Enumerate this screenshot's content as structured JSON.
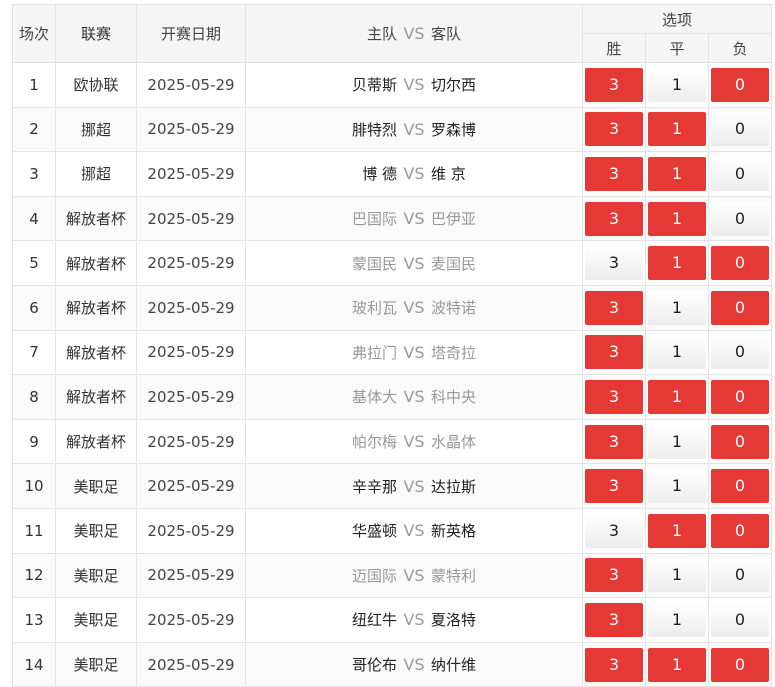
{
  "header": {
    "no": "场次",
    "league": "联赛",
    "date": "开赛日期",
    "home": "主队",
    "vs": "VS",
    "away": "客队",
    "options": "选项",
    "win": "胜",
    "draw": "平",
    "lose": "负"
  },
  "rows": [
    {
      "no": "1",
      "league": "欧协联",
      "date": "2025-05-29",
      "home": "贝蒂斯",
      "vs": "VS",
      "away": "切尔西",
      "win": "3",
      "draw": "1",
      "lose": "0",
      "sel": [
        true,
        false,
        true
      ],
      "dim": [
        false,
        false
      ]
    },
    {
      "no": "2",
      "league": "挪超",
      "date": "2025-05-29",
      "home": "腓特烈",
      "vs": "VS",
      "away": "罗森博",
      "win": "3",
      "draw": "1",
      "lose": "0",
      "sel": [
        true,
        true,
        false
      ],
      "dim": [
        false,
        false
      ]
    },
    {
      "no": "3",
      "league": "挪超",
      "date": "2025-05-29",
      "home": "博 德",
      "vs": "VS",
      "away": "维 京",
      "win": "3",
      "draw": "1",
      "lose": "0",
      "sel": [
        true,
        true,
        false
      ],
      "dim": [
        false,
        false
      ]
    },
    {
      "no": "4",
      "league": "解放者杯",
      "date": "2025-05-29",
      "home": "巴国际",
      "vs": "VS",
      "away": "巴伊亚",
      "win": "3",
      "draw": "1",
      "lose": "0",
      "sel": [
        true,
        true,
        false
      ],
      "dim": [
        true,
        true
      ]
    },
    {
      "no": "5",
      "league": "解放者杯",
      "date": "2025-05-29",
      "home": "蒙国民",
      "vs": "VS",
      "away": "麦国民",
      "win": "3",
      "draw": "1",
      "lose": "0",
      "sel": [
        false,
        true,
        true
      ],
      "dim": [
        true,
        true
      ]
    },
    {
      "no": "6",
      "league": "解放者杯",
      "date": "2025-05-29",
      "home": "玻利瓦",
      "vs": "VS",
      "away": "波特诺",
      "win": "3",
      "draw": "1",
      "lose": "0",
      "sel": [
        true,
        false,
        true
      ],
      "dim": [
        true,
        true
      ]
    },
    {
      "no": "7",
      "league": "解放者杯",
      "date": "2025-05-29",
      "home": "弗拉门",
      "vs": "VS",
      "away": "塔奇拉",
      "win": "3",
      "draw": "1",
      "lose": "0",
      "sel": [
        true,
        false,
        false
      ],
      "dim": [
        true,
        true
      ]
    },
    {
      "no": "8",
      "league": "解放者杯",
      "date": "2025-05-29",
      "home": "基体大",
      "vs": "VS",
      "away": "科中央",
      "win": "3",
      "draw": "1",
      "lose": "0",
      "sel": [
        true,
        true,
        true
      ],
      "dim": [
        true,
        true
      ]
    },
    {
      "no": "9",
      "league": "解放者杯",
      "date": "2025-05-29",
      "home": "帕尔梅",
      "vs": "VS",
      "away": "水晶体",
      "win": "3",
      "draw": "1",
      "lose": "0",
      "sel": [
        true,
        false,
        true
      ],
      "dim": [
        true,
        true
      ]
    },
    {
      "no": "10",
      "league": "美职足",
      "date": "2025-05-29",
      "home": "辛辛那",
      "vs": "VS",
      "away": "达拉斯",
      "win": "3",
      "draw": "1",
      "lose": "0",
      "sel": [
        true,
        false,
        true
      ],
      "dim": [
        false,
        false
      ]
    },
    {
      "no": "11",
      "league": "美职足",
      "date": "2025-05-29",
      "home": "华盛顿",
      "vs": "VS",
      "away": "新英格",
      "win": "3",
      "draw": "1",
      "lose": "0",
      "sel": [
        false,
        true,
        true
      ],
      "dim": [
        false,
        false
      ]
    },
    {
      "no": "12",
      "league": "美职足",
      "date": "2025-05-29",
      "home": "迈国际",
      "vs": "VS",
      "away": "蒙特利",
      "win": "3",
      "draw": "1",
      "lose": "0",
      "sel": [
        true,
        false,
        false
      ],
      "dim": [
        true,
        true
      ]
    },
    {
      "no": "13",
      "league": "美职足",
      "date": "2025-05-29",
      "home": "纽红牛",
      "vs": "VS",
      "away": "夏洛特",
      "win": "3",
      "draw": "1",
      "lose": "0",
      "sel": [
        true,
        false,
        false
      ],
      "dim": [
        false,
        false
      ]
    },
    {
      "no": "14",
      "league": "美职足",
      "date": "2025-05-29",
      "home": "哥伦布",
      "vs": "VS",
      "away": "纳什维",
      "win": "3",
      "draw": "1",
      "lose": "0",
      "sel": [
        true,
        true,
        true
      ],
      "dim": [
        false,
        false
      ]
    }
  ],
  "colors": {
    "selected": "#e53935",
    "header_bg": "#f5f5f5",
    "border": "#e3e3e3"
  }
}
